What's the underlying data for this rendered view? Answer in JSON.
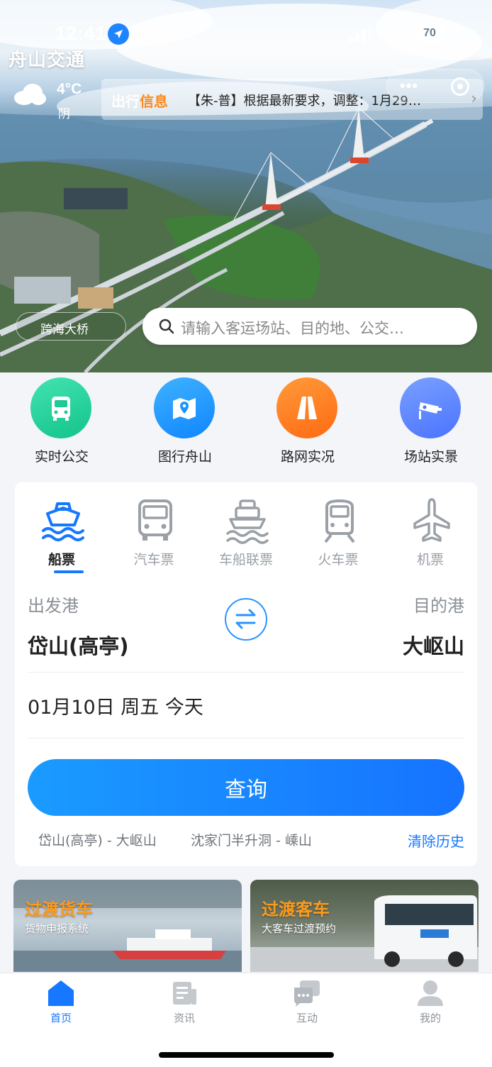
{
  "status_bar": {
    "time": "12:41",
    "battery": "70"
  },
  "brand": "舟山交通",
  "weather": {
    "temp": "4°C",
    "condition": "阴"
  },
  "notice": {
    "title_prefix": "出行",
    "title_highlight": "信息",
    "text": "【朱-普】根据最新要求，调整：1月29…",
    "arrow": "›"
  },
  "capsule": {
    "dots": "•••"
  },
  "hero": {
    "tag": "跨海大桥"
  },
  "search": {
    "placeholder": "请输入客运场站、目的地、公交…"
  },
  "quick_menu": [
    {
      "label": "实时公交",
      "icon": "bus-icon",
      "color": "#2dd39e"
    },
    {
      "label": "图行舟山",
      "icon": "map-pin-icon",
      "color": "#1f9bff"
    },
    {
      "label": "路网实况",
      "icon": "road-icon",
      "color": "#ff7a1c"
    },
    {
      "label": "场站实景",
      "icon": "camera-icon",
      "color": "#5a86ff"
    }
  ],
  "ticket_tabs": [
    {
      "label": "船票",
      "icon": "ship-icon",
      "active": true
    },
    {
      "label": "汽车票",
      "icon": "coach-icon",
      "active": false
    },
    {
      "label": "车船联票",
      "icon": "ferry-icon",
      "active": false
    },
    {
      "label": "火车票",
      "icon": "train-icon",
      "active": false
    },
    {
      "label": "机票",
      "icon": "plane-icon",
      "active": false
    }
  ],
  "route": {
    "departure_label": "出发港",
    "arrival_label": "目的港",
    "departure": "岱山(高亭)",
    "arrival": "大岖山",
    "date": "01月10日 周五 今天"
  },
  "query_button": "查询",
  "history": [
    "岱山(高亭) - 大岖山",
    "沈家门半升洞 - 嵊山"
  ],
  "clear_history": "清除历史",
  "banners": [
    {
      "title": "过渡货车",
      "subtitle": "货物申报系统"
    },
    {
      "title": "过渡客车",
      "subtitle": "大客车过渡预约"
    }
  ],
  "tab_bar": [
    {
      "label": "首页",
      "icon": "home-icon",
      "active": true
    },
    {
      "label": "资讯",
      "icon": "news-icon",
      "active": false
    },
    {
      "label": "互动",
      "icon": "chat-icon",
      "active": false
    },
    {
      "label": "我的",
      "icon": "user-icon",
      "active": false
    }
  ],
  "colors": {
    "accent": "#1677ff",
    "highlight": "#ff8a1c",
    "banner_title": "#ff9a1a"
  }
}
